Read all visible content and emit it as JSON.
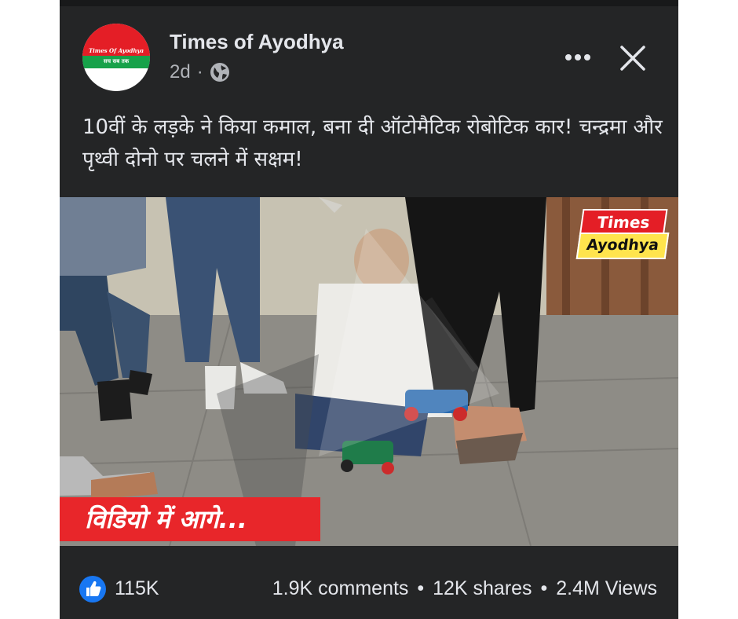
{
  "post": {
    "page_name": "Times of Ayodhya",
    "timestamp": "2d",
    "privacy_icon": "globe-icon",
    "avatar_text_top": "Times Of Ayodhya",
    "avatar_text_bottom": "सच सब तक",
    "caption": "10वीं के लड़के ने किया कमाल, बना दी ऑटोमैटिक रोबोटिक कार! चन्द्रमा और पृथ्वी दोनो पर चलने में सक्षम!"
  },
  "video": {
    "logo_top": "Times",
    "logo_bottom": "Ayodhya",
    "banner_text": "विडियो में आगे..."
  },
  "stats": {
    "likes": "115K",
    "comments": "1.9K comments",
    "shares": "12K shares",
    "views": "2.4M Views",
    "separator": "•"
  },
  "colors": {
    "card_bg": "#242526",
    "text": "#e4e6eb",
    "secondary_text": "#b0b3b8",
    "like_blue": "#1877f2",
    "banner_red": "#e8262a"
  }
}
